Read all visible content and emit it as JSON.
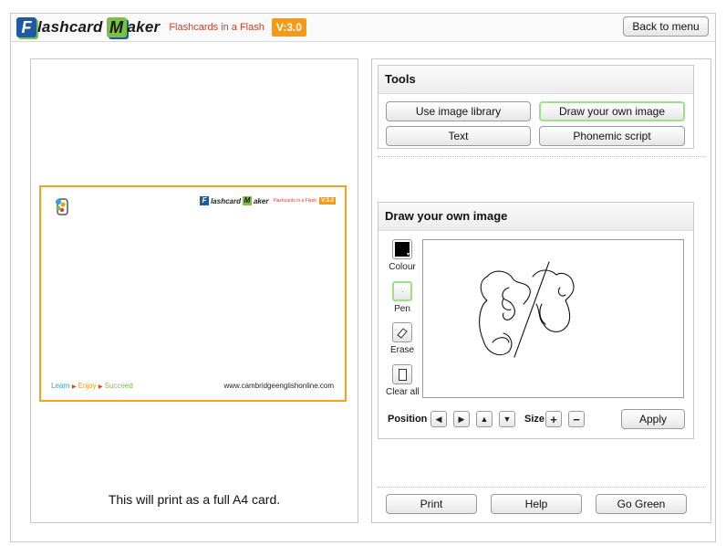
{
  "header": {
    "logo_word1": "lashcard",
    "logo_letter1": "F",
    "logo_word2": "aker",
    "logo_letter2": "M",
    "tagline": "Flashcards in a Flash",
    "version": "V:3.0",
    "back_label": "Back to menu"
  },
  "card": {
    "foot_learn": "Learn",
    "foot_enjoy": "Enjoy",
    "foot_succeed": "Succeed",
    "url": "www.cambridgeenglishonline.com",
    "print_note": "This will print as a full A4 card."
  },
  "tools": {
    "title": "Tools",
    "image_library": "Use image library",
    "draw_image": "Draw your own image",
    "text": "Text",
    "phonemic": "Phonemic script"
  },
  "draw": {
    "title": "Draw your own image",
    "colour_label": "Colour",
    "pen_label": "Pen",
    "erase_label": "Erase",
    "clear_label": "Clear all",
    "position_label": "Position",
    "size_label": "Size",
    "apply_label": "Apply",
    "colour_value": "#000000"
  },
  "footer": {
    "print": "Print",
    "help": "Help",
    "go_green": "Go Green"
  },
  "colors": {
    "accent_orange": "#f39a1b",
    "brand_blue": "#1f5aa8",
    "brand_green": "#7cc043",
    "active_border": "#9ee08a"
  }
}
